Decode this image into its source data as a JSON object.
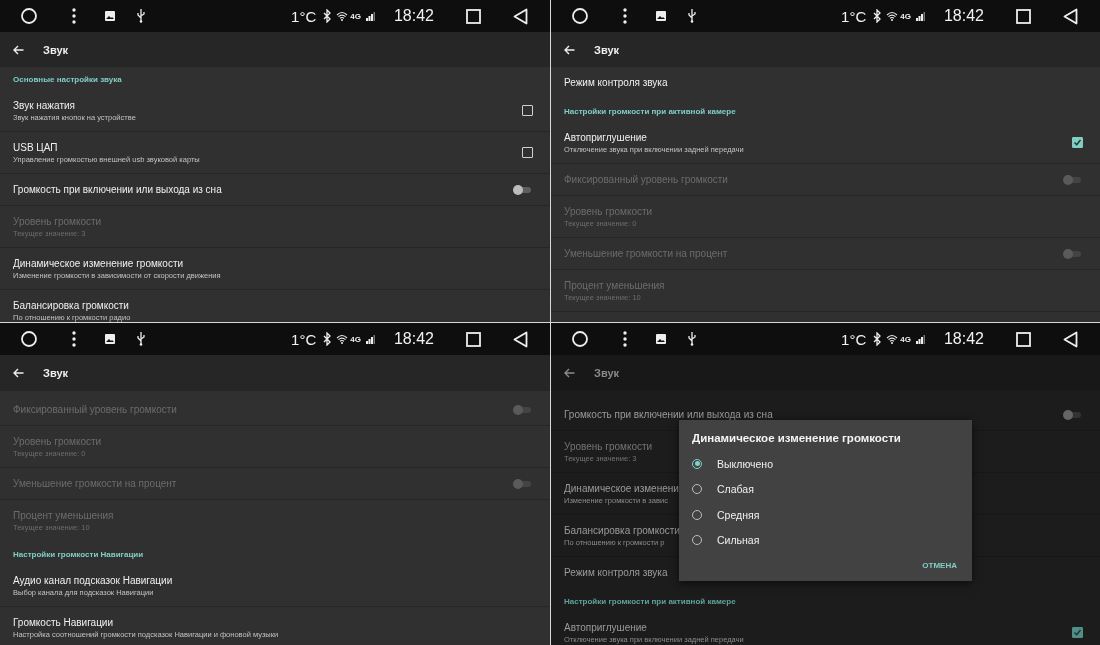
{
  "panels": [
    {
      "status_bar": {
        "temperature": "1°C",
        "network": "4G",
        "time": "18:42"
      },
      "toolbar": {
        "title": "Звук"
      },
      "items": [
        {
          "kind": "header",
          "title": "Основные настройки звука"
        },
        {
          "kind": "checkbox",
          "title": "Звук нажатия",
          "summary": "Звук нажатия кнопок на устройстве",
          "checked": false,
          "disabled": false
        },
        {
          "kind": "checkbox",
          "title": "USB ЦАП",
          "summary": "Управление громкостью внешней usb звуковой карты",
          "checked": false,
          "disabled": false
        },
        {
          "kind": "switch",
          "title": "Громкость при включении или выхода из сна",
          "on": false,
          "disabled": false
        },
        {
          "kind": "pref",
          "title": "Уровень громкости",
          "summary": "Текущее значение: 3",
          "disabled": true
        },
        {
          "kind": "pref",
          "title": "Динамическое изменение громкости",
          "summary": "Изменение громкости в зависимости от скорости движения",
          "disabled": false
        },
        {
          "kind": "pref",
          "title": "Балансировка громкости",
          "summary": "По отношению к громкости радио",
          "disabled": false
        }
      ]
    },
    {
      "status_bar": {
        "temperature": "1°C",
        "network": "4G",
        "time": "18:42"
      },
      "toolbar": {
        "title": "Звук"
      },
      "items": [
        {
          "kind": "pref",
          "title": "Режим контроля звука",
          "disabled": false
        },
        {
          "kind": "header",
          "title": "Настройки громкости при активной камере"
        },
        {
          "kind": "checkbox",
          "title": "Автоприглушение",
          "summary": "Отключение звука при включении задней передачи",
          "checked": true,
          "disabled": false
        },
        {
          "kind": "switch",
          "title": "Фиксированный уровень громкости",
          "on": false,
          "disabled": true
        },
        {
          "kind": "pref",
          "title": "Уровень громкости",
          "summary": "Текущее значение: 0",
          "disabled": true
        },
        {
          "kind": "switch",
          "title": "Уменьшение громкости на процент",
          "on": false,
          "disabled": true
        },
        {
          "kind": "pref",
          "title": "Процент уменьшения",
          "summary": "Текущее значение: 10",
          "disabled": true
        }
      ]
    },
    {
      "status_bar": {
        "temperature": "1°C",
        "network": "4G",
        "time": "18:42"
      },
      "toolbar": {
        "title": "Звук"
      },
      "items": [
        {
          "kind": "switch",
          "title": "Фиксированный уровень громкости",
          "on": false,
          "disabled": true
        },
        {
          "kind": "pref",
          "title": "Уровень громкости",
          "summary": "Текущее значение: 0",
          "disabled": true
        },
        {
          "kind": "switch",
          "title": "Уменьшение громкости на процент",
          "on": false,
          "disabled": true
        },
        {
          "kind": "pref",
          "title": "Процент уменьшения",
          "summary": "Текущее значение: 10",
          "disabled": true
        },
        {
          "kind": "header",
          "title": "Настройки громкости Навигации"
        },
        {
          "kind": "pref",
          "title": "Аудио канал подсказок Навигации",
          "summary": "Выбор канала для подсказок Навигации",
          "disabled": false
        },
        {
          "kind": "pref",
          "title": "Громкость Навигации",
          "summary": "Настройка соотношений громкости подсказок Навигации и фоновой музыки",
          "disabled": false
        }
      ]
    },
    {
      "status_bar": {
        "temperature": "1°C",
        "network": "4G",
        "time": "18:42"
      },
      "toolbar": {
        "title": "Звук"
      },
      "items": [
        {
          "kind": "switch",
          "title": "Громкость при включении или выхода из сна",
          "on": false,
          "disabled": false
        },
        {
          "kind": "pref",
          "title": "Уровень громкости",
          "summary": "Текущее значение: 3",
          "disabled": true
        },
        {
          "kind": "pref",
          "title": "Динамическое изменени",
          "summary": "Изменение громкости в завис",
          "disabled": false
        },
        {
          "kind": "pref",
          "title": "Балансировка громкости",
          "summary": "По отношению к громкости р",
          "disabled": false
        },
        {
          "kind": "pref",
          "title": "Режим контроля звука",
          "disabled": false
        },
        {
          "kind": "header",
          "title": "Настройки громкости при активной камере"
        },
        {
          "kind": "checkbox",
          "title": "Автоприглушение",
          "summary": "Отключение звука при включении задней передачи",
          "checked": true,
          "disabled": false
        }
      ],
      "dialog": {
        "title": "Динамическое изменение громкости",
        "options": [
          {
            "label": "Выключено",
            "selected": true
          },
          {
            "label": "Слабая",
            "selected": false
          },
          {
            "label": "Средняя",
            "selected": false
          },
          {
            "label": "Сильная",
            "selected": false
          }
        ],
        "button": "ОТМЕНА"
      }
    }
  ]
}
